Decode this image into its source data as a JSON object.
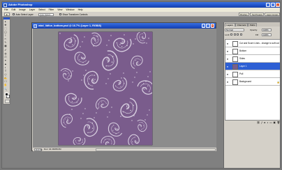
{
  "app": {
    "title": "Adobe Photoshop",
    "window_controls": {
      "minimize": "_",
      "maximize": "□",
      "close": "×"
    }
  },
  "menu": [
    "File",
    "Edit",
    "Image",
    "Layer",
    "Select",
    "Filter",
    "View",
    "Window",
    "Help"
  ],
  "options_bar": {
    "tool_glyph": "▸",
    "auto_select_label": "Auto Select Layer",
    "group_select": "Auto Select Groups",
    "show_transform_label": "Show Transform Controls",
    "right_tabs": [
      "Brushes",
      "Tool Presets",
      "Layer Comps"
    ]
  },
  "toolbox": {
    "tools": [
      "▸",
      "✥",
      "⬚",
      "◯",
      "⌇",
      "✂",
      "✎",
      "▦",
      "✐",
      "◍",
      "⎚",
      "✦",
      "▲",
      "◐",
      "T",
      "⬠",
      "✍",
      "☐",
      "✋",
      "🔍"
    ]
  },
  "document": {
    "title": "wbd_lidfun_bottom.psd @ 16.7% (Layer 1, RGB/8)",
    "zoom": "16.67%",
    "info": "Doc: 34.3M/88.0M",
    "paper_color": "#7a5c8c",
    "pattern_color": "#d8cfe0"
  },
  "layers_panel": {
    "tabs": [
      "Layers",
      "Channels",
      "Paths"
    ],
    "blend_mode": "Normal",
    "opacity_label": "Opacity:",
    "opacity_value": "100%",
    "lock_label": "Lock:",
    "fill_label": "Fill:",
    "fill_value": "100%",
    "layers": [
      {
        "name": "Cut and Score Lines - change to soft cut",
        "visible": true,
        "selected": false,
        "thumb": "#ffffff"
      },
      {
        "name": "Bottom",
        "visible": true,
        "selected": false,
        "thumb": "#ffffff"
      },
      {
        "name": "Sides",
        "visible": true,
        "selected": false,
        "thumb": "#ffffff"
      },
      {
        "name": "Layer 1",
        "visible": true,
        "selected": true,
        "thumb": "#7a5c8c"
      },
      {
        "name": "Pull",
        "visible": true,
        "selected": false,
        "thumb": "#ffffff"
      },
      {
        "name": "Background",
        "visible": true,
        "selected": false,
        "thumb": "#ffffff",
        "locked": true
      }
    ],
    "footer_icons": [
      "link-icon",
      "fx-icon",
      "mask-icon",
      "adjustment-icon",
      "folder-icon",
      "new-layer-icon",
      "trash-icon"
    ],
    "footer_glyphs": [
      "⛓",
      "ƒ",
      "◘",
      "◑",
      "▭",
      "▣",
      "🗑"
    ]
  }
}
